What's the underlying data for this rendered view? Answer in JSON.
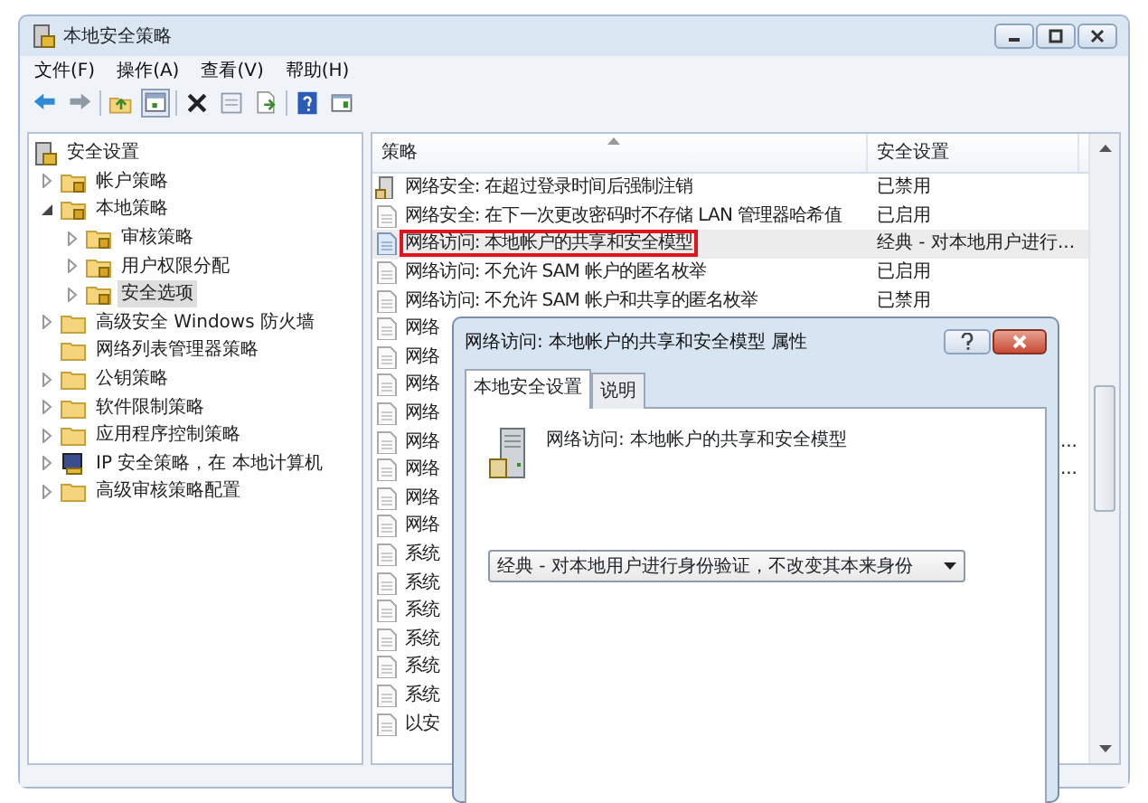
{
  "window": {
    "title": "本地安全策略"
  },
  "menu": [
    "文件(F)",
    "操作(A)",
    "查看(V)",
    "帮助(H)"
  ],
  "toolbar": [
    {
      "kind": "back"
    },
    {
      "kind": "forward"
    },
    {
      "kind": "sep"
    },
    {
      "kind": "up"
    },
    {
      "kind": "tree",
      "selected": true
    },
    {
      "kind": "sep"
    },
    {
      "kind": "delete"
    },
    {
      "kind": "properties"
    },
    {
      "kind": "export"
    },
    {
      "kind": "sep"
    },
    {
      "kind": "help"
    },
    {
      "kind": "view"
    }
  ],
  "tree": {
    "label": "安全设置",
    "children": [
      {
        "label": "帐户策略",
        "kind": "lock-folder",
        "expanded": false,
        "selected": false
      },
      {
        "label": "本地策略",
        "kind": "lock-folder",
        "expanded": true,
        "selected": false,
        "children": [
          {
            "label": "审核策略",
            "kind": "lock-folder",
            "expanded": false,
            "selected": false
          },
          {
            "label": "用户权限分配",
            "kind": "lock-folder",
            "expanded": false,
            "selected": false
          },
          {
            "label": "安全选项",
            "kind": "lock-folder",
            "expanded": false,
            "selected": true
          }
        ]
      },
      {
        "label": "高级安全 Windows 防火墙",
        "kind": "folder",
        "expanded": false,
        "selected": false
      },
      {
        "label": "网络列表管理器策略",
        "kind": "folder",
        "selected": false
      },
      {
        "label": "公钥策略",
        "kind": "folder",
        "expanded": false,
        "selected": false
      },
      {
        "label": "软件限制策略",
        "kind": "folder",
        "expanded": false,
        "selected": false
      },
      {
        "label": "应用程序控制策略",
        "kind": "folder",
        "expanded": false,
        "selected": false
      },
      {
        "label": "IP 安全策略，在 本地计算机",
        "kind": "ip",
        "expanded": false,
        "selected": false
      },
      {
        "label": "高级审核策略配置",
        "kind": "folder",
        "expanded": false,
        "selected": false
      }
    ]
  },
  "table": {
    "columns": [
      "策略",
      "安全设置"
    ],
    "rows": [
      {
        "policy": "网络安全: 在超过登录时间后强制注销",
        "setting": "已禁用",
        "kind": "server",
        "selected": false,
        "highlighted": false
      },
      {
        "policy": "网络安全: 在下一次更改密码时不存储 LAN 管理器哈希值",
        "setting": "已启用",
        "kind": "doc",
        "selected": false,
        "highlighted": false
      },
      {
        "policy": "网络访问: 本地帐户的共享和安全模型",
        "setting": "经典 - 对本地用户进行...",
        "kind": "doc-blue",
        "selected": true,
        "highlighted": true
      },
      {
        "policy": "网络访问: 不允许 SAM 帐户的匿名枚举",
        "setting": "已启用",
        "kind": "doc",
        "selected": false,
        "highlighted": false
      },
      {
        "policy": "网络访问: 不允许 SAM 帐户和共享的匿名枚举",
        "setting": "已禁用",
        "kind": "doc",
        "selected": false,
        "highlighted": false
      },
      {
        "policy": "网络",
        "kind": "doc",
        "selected": false,
        "highlighted": false
      },
      {
        "policy": "网络",
        "kind": "doc",
        "selected": false,
        "highlighted": false
      },
      {
        "policy": "网络",
        "kind": "doc",
        "selected": false,
        "highlighted": false
      },
      {
        "policy": "网络",
        "kind": "doc",
        "selected": false,
        "highlighted": false
      },
      {
        "policy": "网络",
        "setting": "...",
        "kind": "doc",
        "selected": false,
        "highlighted": false
      },
      {
        "policy": "网络",
        "setting": "...",
        "kind": "doc",
        "selected": false,
        "highlighted": false
      },
      {
        "policy": "网络",
        "kind": "doc",
        "selected": false,
        "highlighted": false
      },
      {
        "policy": "网络",
        "kind": "doc",
        "selected": false,
        "highlighted": false
      },
      {
        "policy": "系统",
        "kind": "doc",
        "selected": false,
        "highlighted": false
      },
      {
        "policy": "系统",
        "kind": "doc",
        "selected": false,
        "highlighted": false
      },
      {
        "policy": "系统",
        "kind": "doc",
        "selected": false,
        "highlighted": false
      },
      {
        "policy": "系统",
        "kind": "doc",
        "selected": false,
        "highlighted": false
      },
      {
        "policy": "系统",
        "kind": "doc",
        "selected": false,
        "highlighted": false
      },
      {
        "policy": "系统",
        "kind": "doc",
        "selected": false,
        "highlighted": false
      },
      {
        "policy": "以安",
        "kind": "doc",
        "selected": false,
        "highlighted": false
      }
    ]
  },
  "dialog": {
    "title": "网络访问: 本地帐户的共享和安全模型 属性",
    "tabs": [
      {
        "label": "本地安全设置",
        "selected": true
      },
      {
        "label": "说明",
        "selected": false
      }
    ],
    "policy_name": "网络访问: 本地帐户的共享和安全模型",
    "value": "经典 - 对本地用户进行身份验证，不改变其本来身份"
  }
}
